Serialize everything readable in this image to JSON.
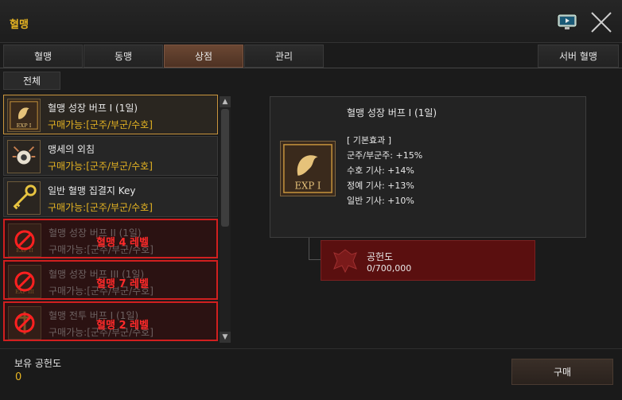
{
  "window": {
    "title": "혈맹"
  },
  "tabs": [
    {
      "label": "혈맹",
      "active": false
    },
    {
      "label": "동맹",
      "active": false
    },
    {
      "label": "상점",
      "active": true
    },
    {
      "label": "관리",
      "active": false
    }
  ],
  "server_tab": "서버 혈맹",
  "subtab": "전체",
  "items": [
    {
      "name": "혈맹 성장 버프 I (1일)",
      "condition": "구매가능:[군주/부군/수호]",
      "state": "selected",
      "icon": "exp-lion-icon",
      "lock_label": ""
    },
    {
      "name": "맹세의 외침",
      "condition": "구매가능:[군주/부군/수호]",
      "state": "normal",
      "icon": "oath-shout-icon",
      "lock_label": ""
    },
    {
      "name": "일반 혈맹 집결지 Key",
      "condition": "구매가능:[군주/부군/수호]",
      "state": "normal",
      "icon": "golden-key-icon",
      "lock_label": ""
    },
    {
      "name": "혈맹 성장 버프 II (1일)",
      "condition": "구매가능:[군주/부군/수호]",
      "state": "locked",
      "icon": "exp-lion-icon",
      "lock_label": "혈맹 4 레벨"
    },
    {
      "name": "혈맹 성장 버프 III (1일)",
      "condition": "구매가능:[군주/부군/수호]",
      "state": "locked",
      "icon": "exp-lion-icon",
      "lock_label": "혈맹 7 레벨"
    },
    {
      "name": "혈맹 전투 버프 I (1일)",
      "condition": "구매가능:[군주/부군/수호]",
      "state": "locked",
      "icon": "battle-buff-icon",
      "lock_label": "혈맹 2 레벨"
    }
  ],
  "detail": {
    "title": "혈맹 성장 버프 I (1일)",
    "section": "[ 기본효과 ]",
    "effects": [
      "군주/부군주: +15%",
      "수호 기사: +14%",
      "정예 기사: +13%",
      "일반 기사: +10%"
    ]
  },
  "cost": {
    "label": "공헌도",
    "value": "0/700,000"
  },
  "owned": {
    "label": "보유 공헌도",
    "value": "0"
  },
  "buy_label": "구매",
  "colors": {
    "accent": "#e6b422",
    "locked": "#d11f1f",
    "tab_active": "#5a3b2b",
    "cost_bg": "#5a0f0f"
  }
}
